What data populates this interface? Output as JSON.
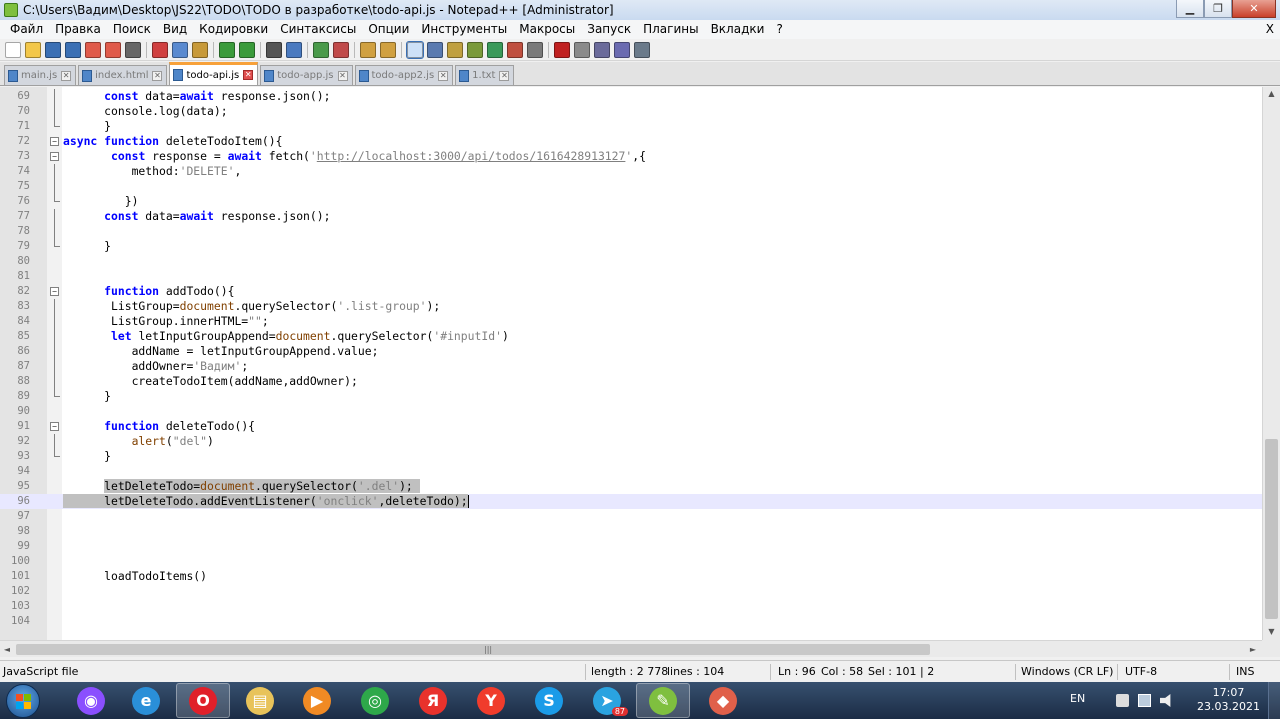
{
  "window": {
    "title": "C:\\Users\\Вадим\\Desktop\\JS22\\TODO\\TODO в разработке\\todo-api.js - Notepad++ [Administrator]",
    "minimize_label": "▁",
    "maximize_label": "❐",
    "close_label": "✕"
  },
  "menu": {
    "items": [
      "Файл",
      "Правка",
      "Поиск",
      "Вид",
      "Кодировки",
      "Синтаксисы",
      "Опции",
      "Инструменты",
      "Макросы",
      "Запуск",
      "Плагины",
      "Вкладки",
      "?"
    ],
    "close_label": "X"
  },
  "toolbar": {
    "icons": [
      "new-file-icon",
      "open-file-icon",
      "save-icon",
      "save-all-icon",
      "close-icon",
      "close-all-icon",
      "print-icon",
      "cut-icon",
      "copy-icon",
      "paste-icon",
      "undo-icon",
      "redo-icon",
      "find-icon",
      "replace-icon",
      "zoom-in-icon",
      "zoom-out-icon",
      "sync-vertical-icon",
      "sync-horizontal-icon",
      "word-wrap-icon",
      "show-all-chars-icon",
      "indent-guide-icon",
      "doc-map-icon",
      "function-list-icon",
      "folder-workspace-icon",
      "monitoring-icon",
      "record-macro-icon",
      "stop-macro-icon",
      "play-macro-icon",
      "run-macro-multiple-icon",
      "save-macro-icon"
    ]
  },
  "tabs": [
    {
      "label": "main.js",
      "active": false
    },
    {
      "label": "index.html",
      "active": false
    },
    {
      "label": "todo-api.js",
      "active": true
    },
    {
      "label": "todo-app.js",
      "active": false
    },
    {
      "label": "todo-app2.js",
      "active": false
    },
    {
      "label": "1.txt",
      "active": false
    }
  ],
  "colors": {
    "keyword": "#0000ff",
    "string": "#808080",
    "object": "#804000",
    "selection": "#c0c0c0",
    "current_line": "#e8e8ff",
    "tab_accent": "#f7a13a"
  },
  "editor": {
    "lines": [
      {
        "n": "69",
        "fold": "line",
        "segs": [
          [
            "",
            "      "
          ],
          [
            "kw",
            "const"
          ],
          [
            "",
            " data="
          ],
          [
            "kw",
            "await"
          ],
          [
            "",
            " response.json();"
          ]
        ]
      },
      {
        "n": "70",
        "fold": "line",
        "segs": [
          [
            "",
            "      console.log(data);"
          ]
        ]
      },
      {
        "n": "71",
        "fold": "end",
        "segs": [
          [
            "",
            "      }"
          ]
        ]
      },
      {
        "n": "72",
        "fold": "box",
        "segs": [
          [
            "kw",
            "async"
          ],
          [
            "",
            " "
          ],
          [
            "kw",
            "function"
          ],
          [
            "",
            " deleteTodoItem(){"
          ]
        ]
      },
      {
        "n": "73",
        "fold": "box",
        "segs": [
          [
            "",
            "       "
          ],
          [
            "kw",
            "const"
          ],
          [
            "",
            " response = "
          ],
          [
            "kw",
            "await"
          ],
          [
            "",
            " fetch("
          ],
          [
            "str",
            "'"
          ],
          [
            "url",
            "http://localhost:3000/api/todos/1616428913127"
          ],
          [
            "str",
            "'"
          ],
          [
            "",
            ",{"
          ]
        ]
      },
      {
        "n": "74",
        "fold": "line",
        "segs": [
          [
            "",
            "          method:"
          ],
          [
            "str",
            "'DELETE'"
          ],
          [
            "",
            ","
          ]
        ]
      },
      {
        "n": "75",
        "fold": "line",
        "segs": [
          [
            "",
            ""
          ]
        ]
      },
      {
        "n": "76",
        "fold": "end",
        "segs": [
          [
            "",
            "         })"
          ]
        ]
      },
      {
        "n": "77",
        "fold": "line",
        "segs": [
          [
            "",
            "      "
          ],
          [
            "kw",
            "const"
          ],
          [
            "",
            " data="
          ],
          [
            "kw",
            "await"
          ],
          [
            "",
            " response.json();"
          ]
        ]
      },
      {
        "n": "78",
        "fold": "line",
        "segs": [
          [
            "",
            ""
          ]
        ]
      },
      {
        "n": "79",
        "fold": "end",
        "segs": [
          [
            "",
            "      }"
          ]
        ]
      },
      {
        "n": "80",
        "fold": "",
        "segs": [
          [
            "",
            ""
          ]
        ]
      },
      {
        "n": "81",
        "fold": "",
        "segs": [
          [
            "",
            ""
          ]
        ]
      },
      {
        "n": "82",
        "fold": "box",
        "segs": [
          [
            "",
            "      "
          ],
          [
            "kw",
            "function"
          ],
          [
            "",
            " addTodo(){"
          ]
        ]
      },
      {
        "n": "83",
        "fold": "line",
        "segs": [
          [
            "",
            "       ListGroup="
          ],
          [
            "obj",
            "document"
          ],
          [
            "",
            ".querySelector("
          ],
          [
            "str",
            "'.list-group'"
          ],
          [
            "",
            ");"
          ]
        ]
      },
      {
        "n": "84",
        "fold": "line",
        "segs": [
          [
            "",
            "       ListGroup.innerHTML="
          ],
          [
            "str",
            "\"\""
          ],
          [
            "",
            ";"
          ]
        ]
      },
      {
        "n": "85",
        "fold": "line",
        "segs": [
          [
            "",
            "       "
          ],
          [
            "kw",
            "let"
          ],
          [
            "",
            " letInputGroupAppend="
          ],
          [
            "obj",
            "document"
          ],
          [
            "",
            ".querySelector("
          ],
          [
            "str",
            "'#inputId'"
          ],
          [
            "",
            ")"
          ]
        ]
      },
      {
        "n": "86",
        "fold": "line",
        "segs": [
          [
            "",
            "          addName = letInputGroupAppend.value;"
          ]
        ]
      },
      {
        "n": "87",
        "fold": "line",
        "segs": [
          [
            "",
            "          addOwner="
          ],
          [
            "str",
            "'Вадим'"
          ],
          [
            "",
            ";"
          ]
        ]
      },
      {
        "n": "88",
        "fold": "line",
        "segs": [
          [
            "",
            "          createTodoItem(addName,addOwner);"
          ]
        ]
      },
      {
        "n": "89",
        "fold": "end",
        "segs": [
          [
            "",
            "      }"
          ]
        ]
      },
      {
        "n": "90",
        "fold": "",
        "segs": [
          [
            "",
            ""
          ]
        ]
      },
      {
        "n": "91",
        "fold": "box",
        "segs": [
          [
            "",
            "      "
          ],
          [
            "kw",
            "function"
          ],
          [
            "",
            " deleteTodo(){"
          ]
        ]
      },
      {
        "n": "92",
        "fold": "line",
        "segs": [
          [
            "",
            "          "
          ],
          [
            "obj",
            "alert"
          ],
          [
            "",
            "("
          ],
          [
            "str",
            "\"del\""
          ],
          [
            "",
            ")"
          ]
        ]
      },
      {
        "n": "93",
        "fold": "end",
        "segs": [
          [
            "",
            "      }"
          ]
        ]
      },
      {
        "n": "94",
        "fold": "",
        "segs": [
          [
            "",
            ""
          ]
        ]
      },
      {
        "n": "95",
        "fold": "",
        "sel": true,
        "segs": [
          [
            "",
            "      "
          ],
          [
            "sel",
            "letDeleteTodo="
          ],
          [
            "sel obj",
            "document"
          ],
          [
            "sel",
            ".querySelector("
          ],
          [
            "sel str",
            "'.del'"
          ],
          [
            "sel",
            ");"
          ],
          [
            "sel",
            " "
          ]
        ]
      },
      {
        "n": "96",
        "fold": "",
        "current": true,
        "segs": [
          [
            "sel",
            "      "
          ],
          [
            "sel",
            "letDeleteTodo.addEventListener("
          ],
          [
            "sel str",
            "'onclick'"
          ],
          [
            "sel",
            ",deleteTodo);"
          ],
          [
            "caret",
            ""
          ]
        ]
      },
      {
        "n": "97",
        "fold": "",
        "segs": [
          [
            "",
            ""
          ]
        ]
      },
      {
        "n": "98",
        "fold": "",
        "segs": [
          [
            "",
            ""
          ]
        ]
      },
      {
        "n": "99",
        "fold": "",
        "segs": [
          [
            "",
            ""
          ]
        ]
      },
      {
        "n": "100",
        "fold": "",
        "segs": [
          [
            "",
            ""
          ]
        ]
      },
      {
        "n": "101",
        "fold": "",
        "segs": [
          [
            "",
            "      loadTodoItems()"
          ]
        ]
      },
      {
        "n": "102",
        "fold": "",
        "segs": [
          [
            "",
            ""
          ]
        ]
      },
      {
        "n": "103",
        "fold": "",
        "segs": [
          [
            "",
            ""
          ]
        ]
      },
      {
        "n": "104",
        "fold": "",
        "segs": [
          [
            "",
            ""
          ]
        ]
      }
    ]
  },
  "scroll": {
    "up": "▲",
    "down": "▼",
    "left": "◄",
    "right": "►",
    "grip": "|||"
  },
  "status": {
    "language": "JavaScript file",
    "length": "length : 2 778",
    "lines": "lines : 104",
    "ln": "Ln : 96",
    "col": "Col : 58",
    "sel": "Sel : 101 | 2",
    "eol": "Windows (CR LF)",
    "encoding": "UTF-8",
    "mode": "INS"
  },
  "taskbar": {
    "apps": [
      {
        "name": "alice-assistant-icon",
        "glyph": "◉",
        "color": "#8a4fff",
        "active": false
      },
      {
        "name": "internet-explorer-icon",
        "glyph": "e",
        "color": "#2a8fd8",
        "active": false
      },
      {
        "name": "opera-icon",
        "glyph": "O",
        "color": "#e0202a",
        "active": true
      },
      {
        "name": "file-explorer-icon",
        "glyph": "▤",
        "color": "#e8c35a",
        "active": false
      },
      {
        "name": "media-player-icon",
        "glyph": "▶",
        "color": "#f08a24",
        "active": false
      },
      {
        "name": "chrome-icon",
        "glyph": "◎",
        "color": "#2ea84a",
        "active": false
      },
      {
        "name": "yandex-icon",
        "glyph": "Я",
        "color": "#e8322c",
        "active": false
      },
      {
        "name": "yandex-browser-icon",
        "glyph": "Y",
        "color": "#f03c2c",
        "active": false
      },
      {
        "name": "skype-icon",
        "glyph": "S",
        "color": "#1a9be8",
        "active": false
      },
      {
        "name": "telegram-icon",
        "glyph": "➤",
        "color": "#2aa3e0",
        "active": false
      },
      {
        "name": "notepad-plus-plus-icon",
        "glyph": "✎",
        "color": "#7fbf3f",
        "active": true
      },
      {
        "name": "git-icon",
        "glyph": "◆",
        "color": "#e0604a",
        "active": false
      }
    ],
    "telegram_badge": "87",
    "lang": "EN",
    "time": "17:07",
    "date": "23.03.2021"
  }
}
